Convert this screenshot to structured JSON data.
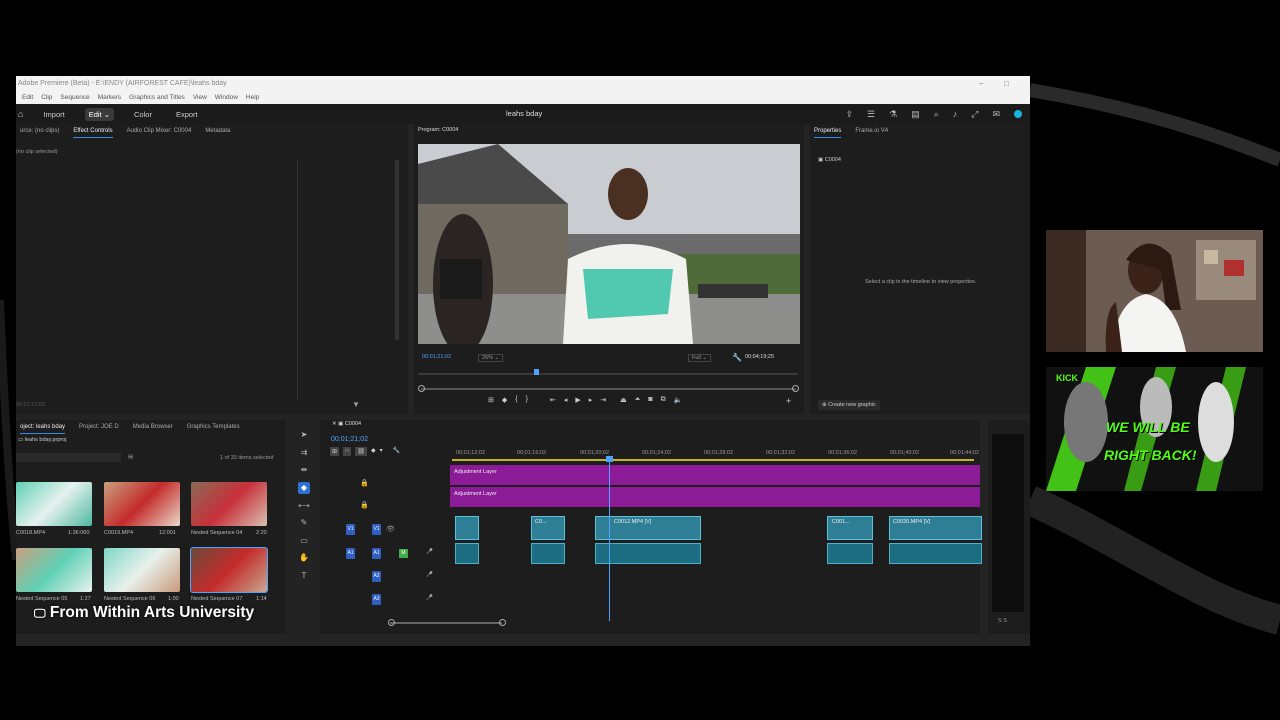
{
  "app": {
    "window_title": "Adobe Premiere (Beta) - E:\\ENDY (AIRFOREST CAFE)\\leahs bday",
    "project_name": "leahs bday"
  },
  "menu": [
    "Edit",
    "Clip",
    "Sequence",
    "Markers",
    "Graphics and Titles",
    "View",
    "Window",
    "Help"
  ],
  "workspace": {
    "import": "Import",
    "edit": "Edit",
    "color": "Color",
    "export": "Export"
  },
  "source_panel": {
    "tabs": [
      "urce: (no clips)",
      "Effect Controls",
      "Audio Clip Mixer: C0004",
      "Metadata"
    ],
    "no_clip": "(no clip selected)",
    "timecode": "00;01;21;02"
  },
  "program": {
    "title": "Program: C0004",
    "timecode": "00;01;21;02",
    "zoom": "26%",
    "quality": "Full",
    "duration": "00;04;19;25"
  },
  "properties": {
    "tabs": [
      "Properties",
      "Frame.io V4"
    ],
    "item": "C0004",
    "hint": "Select a clip in the timeline to view properties.",
    "create_graphic": "Create new graphic"
  },
  "project": {
    "tabs": [
      "oject: leahs bday",
      "Project: JOE D",
      "Media Browser",
      "Graphics Templates"
    ],
    "file": "leahs bday.prproj",
    "selection": "1 of 33 items selected",
    "items": [
      {
        "name": "C0018.MP4",
        "duration": "1:36:060"
      },
      {
        "name": "C0019.MP4",
        "duration": "12:001"
      },
      {
        "name": "Nested Sequence 04",
        "duration": "2:20"
      },
      {
        "name": "Nested Sequence 05",
        "duration": "1:27"
      },
      {
        "name": "Nested Sequence 06",
        "duration": "1:00"
      },
      {
        "name": "Nested Sequence 07",
        "duration": "1:14"
      }
    ]
  },
  "timeline": {
    "sequence": "C0004",
    "timecode": "00;01;21;02",
    "ruler": [
      "00;01;12;02",
      "00;01;16;02",
      "00;01;20;02",
      "00;01;24;02",
      "00;01;28;02",
      "00;01;32;02",
      "00;01;36;02",
      "00;01;40;02",
      "00;01;44;02"
    ],
    "tracks": [
      "V1",
      "A1",
      "A2",
      "A3"
    ],
    "adjustment_label": "Adjustment Layer",
    "clips": [
      "C0...",
      "C0012.MP4 [V]",
      "C001...",
      "C0020.MP4 [V]"
    ]
  },
  "overlay": {
    "watermark": "From Within Arts University",
    "promo_brand": "KICK",
    "promo_text_1": "WE WILL BE",
    "promo_text_2": "RIGHT BACK!"
  },
  "colors": {
    "accent": "#2d8ceb",
    "adjustment": "#8b1b96",
    "clip": "#2e7f96",
    "kick_green": "#53fc18"
  }
}
